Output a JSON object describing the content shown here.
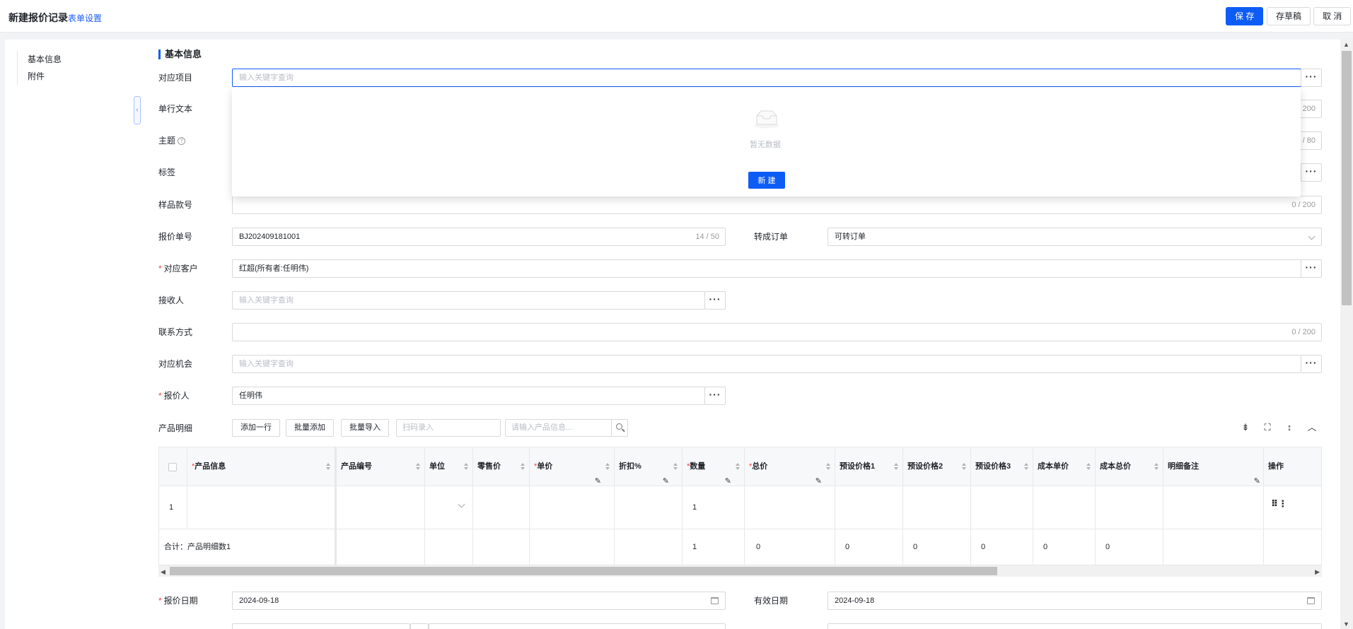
{
  "header": {
    "title": "新建报价记录",
    "form_settings": "表单设置",
    "save": "保 存",
    "draft": "存草稿",
    "cancel": "取 消"
  },
  "anchor_nav": [
    "基本信息",
    "附件"
  ],
  "section": {
    "title": "基本信息"
  },
  "fields": {
    "project": {
      "label": "对应项目",
      "placeholder": "输入关键字查询"
    },
    "single_text": {
      "label": "单行文本",
      "counter": "200"
    },
    "subject": {
      "label": "主题",
      "counter": "/ 80"
    },
    "tags": {
      "label": "标签"
    },
    "sample_no": {
      "label": "样品款号",
      "counter": "0 / 200"
    },
    "quote_no": {
      "label": "报价单号",
      "value": "BJ202409181001",
      "counter": "14 / 50"
    },
    "to_order": {
      "label": "转成订单",
      "value": "可转订单"
    },
    "customer": {
      "label": "对应客户",
      "value": "红超(所有者:任明伟)"
    },
    "receiver": {
      "label": "接收人",
      "placeholder": "输入关键字查询"
    },
    "contact": {
      "label": "联系方式",
      "counter": "0 / 200"
    },
    "opportunity": {
      "label": "对应机会",
      "placeholder": "输入关键字查询"
    },
    "quoter": {
      "label": "报价人",
      "value": "任明伟"
    },
    "quote_date": {
      "label": "报价日期",
      "value": "2024-09-18"
    },
    "valid_date": {
      "label": "有效日期",
      "value": "2024-09-18"
    }
  },
  "dropdown": {
    "empty_text": "暂无数据",
    "new_button": "新 建"
  },
  "products": {
    "label": "产品明细",
    "add_row": "添加一行",
    "batch_add": "批量添加",
    "batch_import": "批量导入",
    "scan_placeholder": "扫码录入",
    "search_placeholder": "请输入产品信息...",
    "columns": [
      "产品信息",
      "产品编号",
      "单位",
      "零售价",
      "单价",
      "折扣%",
      "数量",
      "总价",
      "预设价格1",
      "预设价格2",
      "预设价格3",
      "成本单价",
      "成本总价",
      "明细备注",
      "操作"
    ],
    "row": {
      "index": "1",
      "quantity": "1"
    },
    "total": {
      "label": "合计：产品明细数1",
      "quantity": "1",
      "total_price": "0",
      "preset1": "0",
      "preset2": "0",
      "preset3": "0",
      "cost_unit": "0",
      "cost_total": "0"
    }
  }
}
